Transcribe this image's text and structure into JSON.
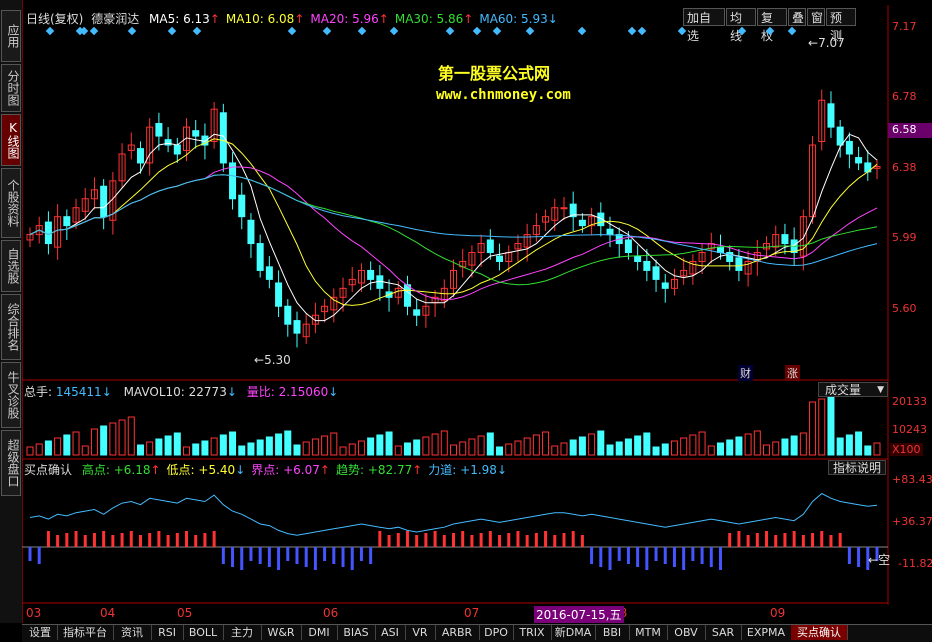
{
  "left_tabs": [
    "应用",
    "分时图",
    "K线图",
    "个股资料",
    "自选股",
    "综合排名",
    "牛叉诊股",
    "超级盘口"
  ],
  "header": {
    "period": "日线(复权)",
    "stock_name": "德豪润达",
    "ma": [
      {
        "label": "MA5: 6.13",
        "arrow": "↑",
        "color": "#ffffff"
      },
      {
        "label": "MA10: 6.08",
        "arrow": "↑",
        "color": "#ffff33"
      },
      {
        "label": "MA20: 5.96",
        "arrow": "↑",
        "color": "#ff44ff"
      },
      {
        "label": "MA30: 5.86",
        "arrow": "↑",
        "color": "#33dd33"
      },
      {
        "label": "MA60: 5.93",
        "arrow": "↓",
        "color": "#44bbff"
      }
    ]
  },
  "toolbar": [
    "加自选",
    "均线",
    "复权",
    "叠",
    "窗",
    "预测"
  ],
  "watermark": {
    "title": "第一股票公式网",
    "url": "www.chnmoney.com"
  },
  "price_axis": [
    "7.17",
    "6.78",
    "6.58",
    "6.38",
    "5.99",
    "5.60"
  ],
  "price_marks": {
    "high": "7.07",
    "low": "5.30"
  },
  "event_tags": [
    "财",
    "涨"
  ],
  "volume_panel": {
    "total_label": "总手:",
    "total_value": "145411",
    "total_arrow": "↓",
    "mavol_label": "MAVOL10:",
    "mavol_value": "22773",
    "mavol_arrow": "↓",
    "ratio_label": "量比:",
    "ratio_value": "2.15060",
    "ratio_arrow": "↓",
    "selector": "成交量",
    "axis": [
      "20133",
      "10243",
      "X100"
    ]
  },
  "indicator_panel": {
    "name": "买点确认",
    "items": [
      {
        "label": "高点:",
        "value": "+6.18",
        "arrow": "↑",
        "color": "#33dd33"
      },
      {
        "label": "低点:",
        "value": "+5.40",
        "arrow": "↓",
        "color": "#ffff33"
      },
      {
        "label": "界点:",
        "value": "+6.07",
        "arrow": "↑",
        "color": "#ff44ff"
      },
      {
        "label": "趋势:",
        "value": "+82.77",
        "arrow": "↑",
        "color": "#33dd33"
      },
      {
        "label": "力道:",
        "value": "+1.98",
        "arrow": "↓",
        "color": "#44bbff"
      }
    ],
    "explain_button": "指标说明",
    "axis": [
      "+83.43",
      "+36.37",
      "-11.82"
    ],
    "empty_tag": "空"
  },
  "x_axis": [
    "03",
    "04",
    "05",
    "06",
    "07",
    "08",
    "09"
  ],
  "cursor_date": "2016-07-15,五",
  "bottom_tabs": [
    "设置",
    "指标平台",
    "资讯",
    "RSI",
    "BOLL",
    "主力",
    "W&R",
    "DMI",
    "BIAS",
    "ASI",
    "VR",
    "ARBR",
    "DPO",
    "TRIX",
    "新DMA",
    "BBI",
    "MTM",
    "OBV",
    "SAR",
    "EXPMA",
    "买点确认"
  ],
  "active_bottom_tab": "买点确认",
  "colors": {
    "up": "#ff3333",
    "down": "#44ffff",
    "axis": "#cc2222",
    "ma5": "#ffffff",
    "ma10": "#ffff33",
    "ma20": "#ff44ff",
    "ma30": "#33dd33",
    "ma60": "#44bbff"
  },
  "chart_data": {
    "type": "candlestick",
    "ylim": [
      5.3,
      7.17
    ],
    "x_months": [
      "03",
      "04",
      "05",
      "06",
      "07",
      "08",
      "09"
    ],
    "close": [
      6.0,
      6.05,
      5.95,
      6.1,
      6.05,
      6.15,
      6.2,
      6.25,
      6.1,
      6.3,
      6.45,
      6.5,
      6.4,
      6.6,
      6.55,
      6.5,
      6.45,
      6.6,
      6.55,
      6.5,
      6.7,
      6.4,
      6.2,
      6.1,
      5.95,
      5.8,
      5.75,
      5.6,
      5.5,
      5.45,
      5.5,
      5.55,
      5.6,
      5.65,
      5.7,
      5.75,
      5.8,
      5.75,
      5.7,
      5.65,
      5.7,
      5.6,
      5.55,
      5.6,
      5.65,
      5.7,
      5.8,
      5.85,
      5.9,
      5.95,
      5.9,
      5.85,
      5.9,
      5.95,
      6.0,
      6.05,
      6.1,
      6.15,
      6.15,
      6.1,
      6.05,
      6.1,
      6.05,
      6.0,
      5.95,
      5.9,
      5.85,
      5.8,
      5.75,
      5.7,
      5.75,
      5.8,
      5.85,
      5.9,
      5.95,
      5.9,
      5.85,
      5.8,
      5.85,
      5.9,
      5.95,
      6.0,
      5.95,
      5.9,
      6.1,
      6.5,
      6.75,
      6.6,
      6.5,
      6.45,
      6.4,
      6.35,
      6.38
    ]
  }
}
